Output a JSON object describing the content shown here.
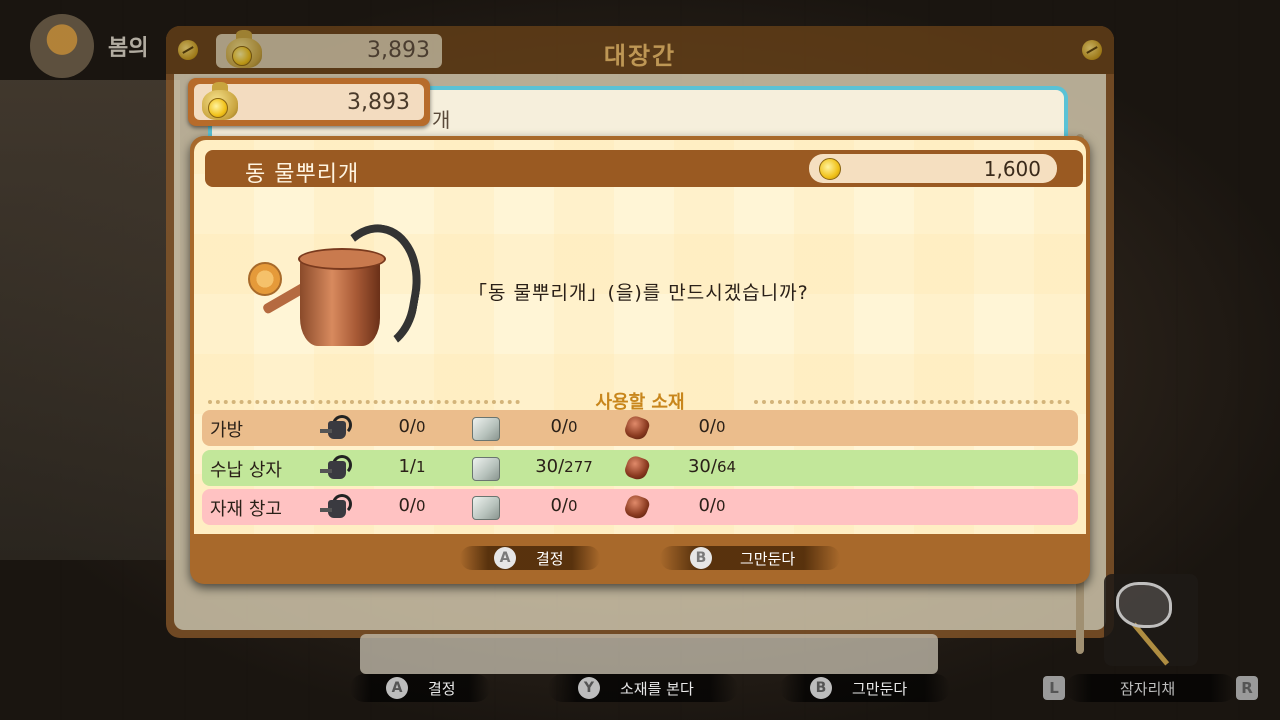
{
  "background": {
    "season_label": "봄의"
  },
  "back_window": {
    "title": "대장간",
    "money": "3,893",
    "list_item_fragment": "개"
  },
  "money_plate": {
    "amount": "3,893"
  },
  "dialog": {
    "item_name": "동 물뿌리개",
    "price": "1,600",
    "question": "「동 물뿌리개」(을)를 만드시겠습니까?",
    "materials_title": "사용할 소재",
    "storage_rows": [
      {
        "label": "가방",
        "can": {
          "have": "0",
          "total": "0"
        },
        "stone": {
          "have": "0",
          "total": "0"
        },
        "ore": {
          "have": "0",
          "total": "0"
        }
      },
      {
        "label": "수납 상자",
        "can": {
          "have": "1",
          "total": "1"
        },
        "stone": {
          "have": "30",
          "total": "277"
        },
        "ore": {
          "have": "30",
          "total": "64"
        }
      },
      {
        "label": "자재 창고",
        "can": {
          "have": "0",
          "total": "0"
        },
        "stone": {
          "have": "0",
          "total": "0"
        },
        "ore": {
          "have": "0",
          "total": "0"
        }
      }
    ],
    "buttons": {
      "confirm": {
        "key": "A",
        "label": "결정"
      },
      "cancel": {
        "key": "B",
        "label": "그만둔다"
      }
    }
  },
  "global_bar": {
    "confirm": {
      "key": "A",
      "label": "결정"
    },
    "view_materials": {
      "key": "Y",
      "label": "소재를 본다"
    },
    "cancel": {
      "key": "B",
      "label": "그만둔다"
    },
    "left_shoulder": "L",
    "right_shoulder": "R",
    "tool_label": "잠자리채"
  },
  "colors": {
    "dialog_frame": "#a8692b",
    "title_bar": "#9a5a22",
    "row_bag": "#ebbd8c",
    "row_box": "#c2e79a",
    "row_warehouse": "#ffc2c2",
    "materials_title": "#c8861c",
    "back_title": "#f2c06a"
  },
  "icons": {
    "currency": "coin-icon",
    "money_bag": "money-bag-icon",
    "material_1": "watering-can-icon",
    "material_2": "stone-icon",
    "material_3": "copper-ore-icon"
  }
}
